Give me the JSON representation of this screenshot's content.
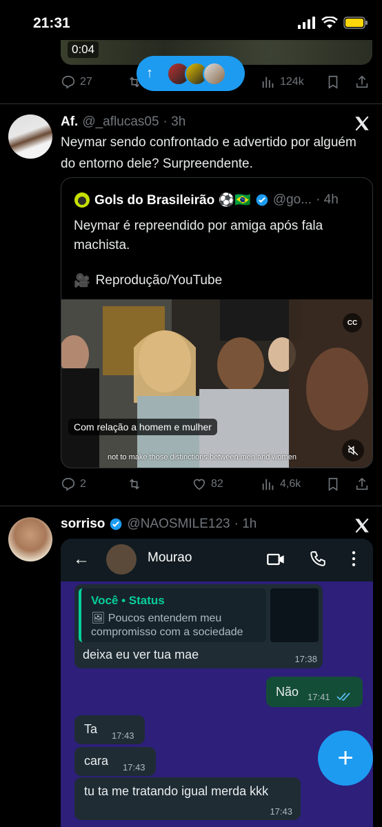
{
  "status_bar": {
    "time": "21:31"
  },
  "prev_tweet": {
    "video_duration": "0:04",
    "actions": {
      "replies": "27",
      "views": "124k"
    }
  },
  "new_posts_pill": {
    "arrow": "↑"
  },
  "tweet1": {
    "name": "Af.",
    "handle": "@_aflucas05",
    "time": "· 3h",
    "text": "Neymar sendo confrontado e advertido por alguém do entorno dele? Surpreendente.",
    "quote": {
      "name": "Gols do Brasileirão ⚽🇧🇷",
      "handle": "@go...",
      "time": "· 4h",
      "text": "Neymar é repreendido por amiga após fala machista.",
      "source": "Reprodução/YouTube",
      "caption_pt": "Com relação a homem e mulher",
      "caption_en": "not to make those distinctions between men and women",
      "cc_label": "CC"
    },
    "actions": {
      "replies": "2",
      "likes": "82",
      "views": "4,6k"
    }
  },
  "tweet2": {
    "name": "sorriso",
    "handle": "@NAOSMILE123",
    "time": "· 1h",
    "whatsapp": {
      "contact": "Mourao",
      "back": "←",
      "reply_to": "Você • Status",
      "reply_text": "Poucos entendem meu compromisso com a sociedade",
      "messages": [
        {
          "text": "deixa eu ver tua mae",
          "time": "17:38"
        },
        {
          "text": "Não",
          "time": "17:41"
        },
        {
          "text": "Ta",
          "time": "17:43"
        },
        {
          "text": "cara",
          "time": "17:43"
        },
        {
          "text": "tu ta me tratando igual merda kkk",
          "time": "17:43"
        }
      ]
    }
  },
  "fab": {
    "label": "+"
  },
  "colors": {
    "accent": "#1d9bf0",
    "background": "#000000",
    "secondary_text": "#71767b"
  }
}
